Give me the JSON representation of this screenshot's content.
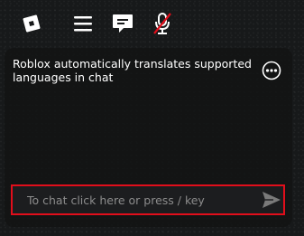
{
  "topbar": {
    "icons": [
      "roblox-logo-icon",
      "hamburger-menu-icon",
      "chat-bubble-icon",
      "microphone-muted-icon"
    ],
    "accent_color": "#e10e1b"
  },
  "chat": {
    "message": "Roblox automatically translates supported languages in chat",
    "more_icon": "more-options-icon"
  },
  "chat_input": {
    "placeholder": "To chat click here or press / key",
    "value": "",
    "send_icon": "send-icon"
  }
}
